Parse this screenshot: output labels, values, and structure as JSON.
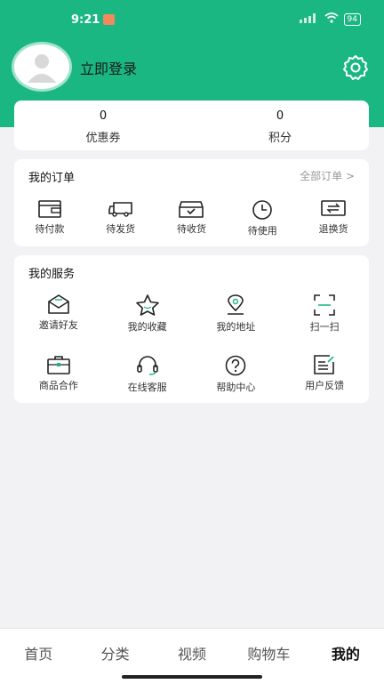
{
  "status": {
    "time": "9:21",
    "battery": "94"
  },
  "profile": {
    "login_label": "立即登录"
  },
  "stats": [
    {
      "value": "0",
      "label": "优惠券"
    },
    {
      "value": "0",
      "label": "积分"
    }
  ],
  "orders": {
    "title": "我的订单",
    "all_link": "全部订单 >",
    "items": [
      {
        "label": "待付款",
        "icon": "wallet-icon"
      },
      {
        "label": "待发货",
        "icon": "truck-icon"
      },
      {
        "label": "待收货",
        "icon": "inbox-icon"
      },
      {
        "label": "待使用",
        "icon": "clock-icon"
      },
      {
        "label": "退换货",
        "icon": "exchange-icon"
      }
    ]
  },
  "services": {
    "title": "我的服务",
    "items": [
      {
        "label": "邀请好友",
        "icon": "envelope-icon"
      },
      {
        "label": "我的收藏",
        "icon": "star-icon"
      },
      {
        "label": "我的地址",
        "icon": "location-icon"
      },
      {
        "label": "扫一扫",
        "icon": "scan-icon"
      },
      {
        "label": "商品合作",
        "icon": "briefcase-icon"
      },
      {
        "label": "在线客服",
        "icon": "headset-icon"
      },
      {
        "label": "帮助中心",
        "icon": "help-icon"
      },
      {
        "label": "用户反馈",
        "icon": "feedback-icon"
      }
    ]
  },
  "tabbar": [
    {
      "label": "首页"
    },
    {
      "label": "分类"
    },
    {
      "label": "视频"
    },
    {
      "label": "购物车"
    },
    {
      "label": "我的"
    }
  ],
  "colors": {
    "brand": "#1bb783"
  }
}
